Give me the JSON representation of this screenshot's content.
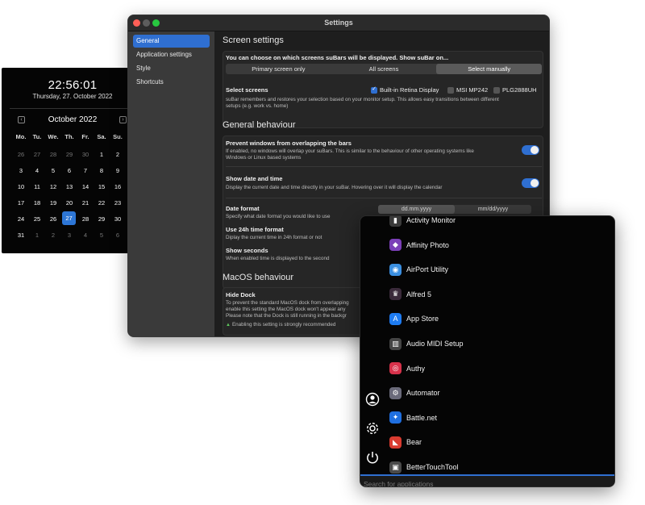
{
  "calendar": {
    "time": "22:56:01",
    "date": "Thursday, 27. October 2022",
    "month": "October 2022",
    "prev_icon": "‹",
    "next_icon": "›",
    "weekdays": [
      "Mo.",
      "Tu.",
      "We.",
      "Th.",
      "Fr.",
      "Sa.",
      "Su."
    ],
    "weeks": [
      [
        "26",
        "27",
        "28",
        "29",
        "30",
        "1",
        "2"
      ],
      [
        "3",
        "4",
        "5",
        "6",
        "7",
        "8",
        "9"
      ],
      [
        "10",
        "11",
        "12",
        "13",
        "14",
        "15",
        "16"
      ],
      [
        "17",
        "18",
        "19",
        "20",
        "21",
        "22",
        "23"
      ],
      [
        "24",
        "25",
        "26",
        "27",
        "28",
        "29",
        "30"
      ],
      [
        "31",
        "1",
        "2",
        "3",
        "4",
        "5",
        "6"
      ]
    ],
    "today": "27"
  },
  "settings": {
    "title": "Settings",
    "sidebar": [
      "General",
      "Application settings",
      "Style",
      "Shortcuts"
    ],
    "screen": {
      "title": "Screen settings",
      "choose_label": "You can choose on which screens suBars will be displayed. Show suBar on...",
      "options": [
        "Primary screen only",
        "All screens",
        "Select manually"
      ],
      "select_title": "Select screens",
      "screens": [
        {
          "label": "Built-in Retina Display",
          "checked": true
        },
        {
          "label": "MSI MP242",
          "checked": false
        },
        {
          "label": "PLG2888UH",
          "checked": false
        }
      ],
      "select_desc_1": "suBar remembers and restores your selection based on your monitor setup. This allows easy transitions between different",
      "select_desc_2": "setups (e.g. work vs. home)"
    },
    "general": {
      "title": "General behaviour",
      "prevent_title": "Prevent windows from overlapping the bars",
      "prevent_desc_1": "If enabled, no windows will overlap your suBars. This is similar to the behaviour of other operating systems like",
      "prevent_desc_2": "Windows or Linux based systems",
      "showdate_title": "Show date and time",
      "showdate_desc": "Display the current date and time directly in your suBar. Hovering over it will display the calendar",
      "format_title": "Date format",
      "format_desc": "Specify what date format you would like to use",
      "format_options": [
        "dd.mm.yyyy",
        "mm/dd/yyyy"
      ],
      "h24_title": "Use 24h time format",
      "h24_desc": "Diplay the current time in 24h format or not",
      "seconds_title": "Show seconds",
      "seconds_desc": "When enabled time is displayed to the second"
    },
    "macos": {
      "title": "MacOS behaviour",
      "dock_title": "Hide Dock",
      "dock_desc_1": "To prevent the standard MacOS dock from overlapping",
      "dock_desc_2": "enable this setting the MacOS dock won't appear any",
      "dock_desc_3": "Please note that the Dock is still running in the backgr",
      "dock_note": "Enabling this setting is strongly recommended"
    }
  },
  "launcher": {
    "apps": [
      {
        "name": "Activity Monitor",
        "icon": "activity-monitor-icon",
        "color": "#3a3a3a"
      },
      {
        "name": "Affinity Photo",
        "icon": "affinity-photo-icon",
        "color": "#7b3fb8"
      },
      {
        "name": "AirPort Utility",
        "icon": "airport-utility-icon",
        "color": "#3b8fe0"
      },
      {
        "name": "Alfred 5",
        "icon": "alfred-icon",
        "color": "#3a2a3a"
      },
      {
        "name": "App Store",
        "icon": "app-store-icon",
        "color": "#1e7cf2"
      },
      {
        "name": "Audio MIDI Setup",
        "icon": "audio-midi-icon",
        "color": "#444444"
      },
      {
        "name": "Authy",
        "icon": "authy-icon",
        "color": "#d7324b"
      },
      {
        "name": "Automator",
        "icon": "automator-icon",
        "color": "#6a6a7a"
      },
      {
        "name": "Battle.net",
        "icon": "battlenet-icon",
        "color": "#1f6fe0"
      },
      {
        "name": "Bear",
        "icon": "bear-icon",
        "color": "#d93b30"
      },
      {
        "name": "BetterTouchTool",
        "icon": "bettertouchtool-icon",
        "color": "#4a4a4a"
      }
    ],
    "search_placeholder": "Search for applications",
    "accent": "#2f6fd1"
  }
}
